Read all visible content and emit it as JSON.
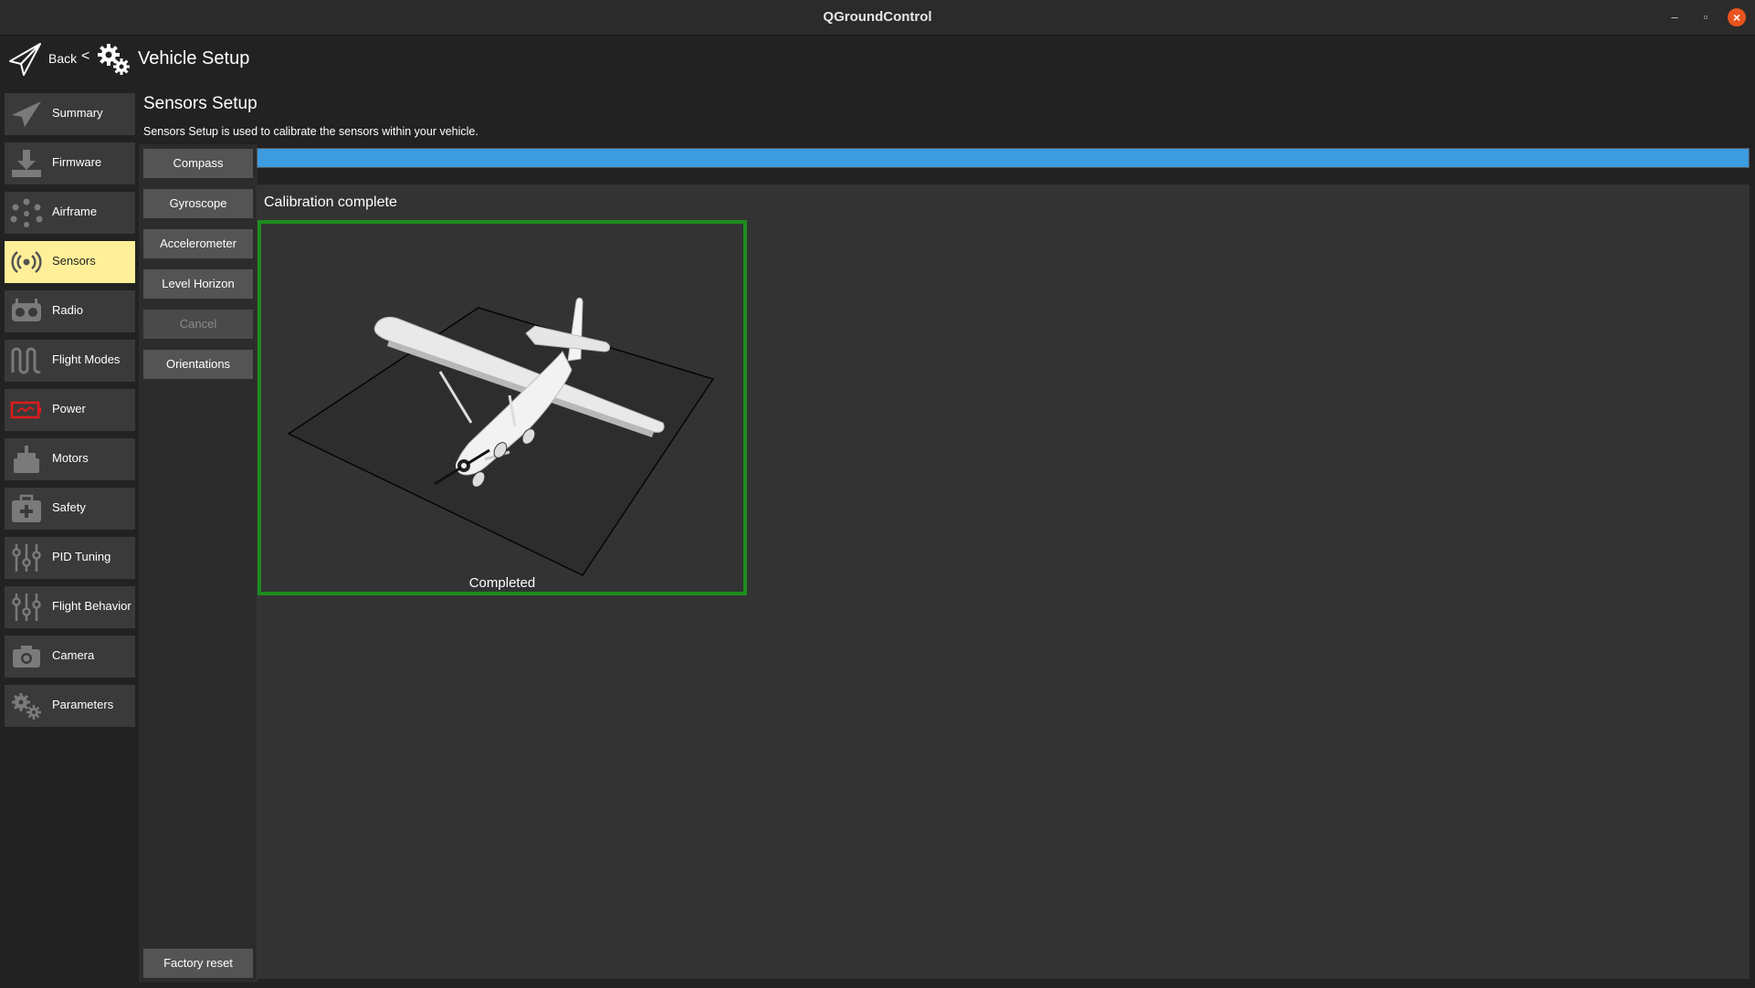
{
  "window": {
    "title": "QGroundControl"
  },
  "header": {
    "back_label": "Back",
    "separator": "<",
    "title": "Vehicle Setup"
  },
  "nav": {
    "items": [
      {
        "label": "Summary",
        "icon": "paper-plane-icon"
      },
      {
        "label": "Firmware",
        "icon": "download-icon"
      },
      {
        "label": "Airframe",
        "icon": "airframe-dots-icon"
      },
      {
        "label": "Sensors",
        "icon": "radio-waves-icon",
        "active": true
      },
      {
        "label": "Radio",
        "icon": "radio-controller-icon"
      },
      {
        "label": "Flight Modes",
        "icon": "wave-icon"
      },
      {
        "label": "Power",
        "icon": "battery-icon"
      },
      {
        "label": "Motors",
        "icon": "motor-icon"
      },
      {
        "label": "Safety",
        "icon": "first-aid-icon"
      },
      {
        "label": "PID Tuning",
        "icon": "sliders-icon"
      },
      {
        "label": "Flight Behavior",
        "icon": "sliders-icon"
      },
      {
        "label": "Camera",
        "icon": "camera-icon"
      },
      {
        "label": "Parameters",
        "icon": "gears-icon"
      }
    ],
    "active_color": "#ffef99"
  },
  "sensors": {
    "title": "Sensors Setup",
    "description": "Sensors Setup is used to calibrate the sensors within your vehicle.",
    "buttons": {
      "compass": "Compass",
      "gyroscope": "Gyroscope",
      "accelerometer": "Accelerometer",
      "level_horizon": "Level Horizon",
      "cancel": "Cancel",
      "orientations": "Orientations",
      "factory_reset": "Factory reset"
    },
    "progress": 1.0,
    "progress_color": "#3d9be0",
    "status": "Calibration complete",
    "calibration_label": "Completed",
    "calibration_border_color": "#1d8c1d"
  }
}
